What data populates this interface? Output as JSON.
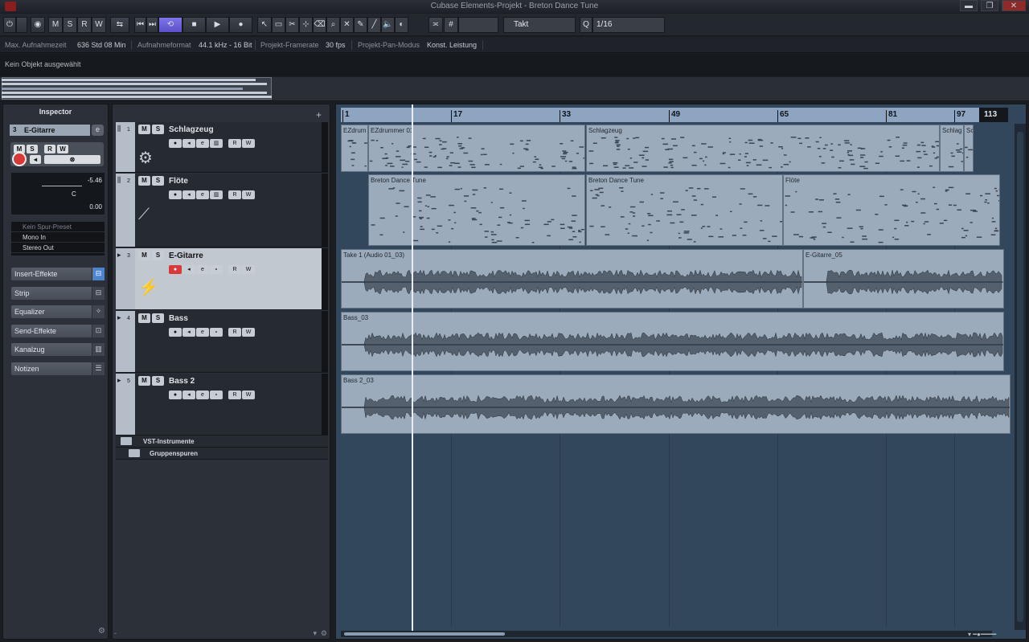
{
  "window": {
    "title": "Cubase Elements-Projekt - Breton Dance Tune",
    "minimize": "▬",
    "restore": "❐",
    "close": "✕"
  },
  "toolbar": {
    "btn_activate": "⏻",
    "btn_constrain": "◉",
    "btn_m": "M",
    "btn_s": "S",
    "btn_r": "R",
    "btn_w": "W",
    "btn_automation": "⇆",
    "btn_prev": "⏮",
    "btn_next": "⏭",
    "btn_cycle": "⟲",
    "btn_stop": "■",
    "btn_play": "▶",
    "btn_record": "●",
    "tool_arrow": "↖",
    "tool_range": "▭",
    "tool_split": "✂",
    "tool_glue": "⊹",
    "tool_erase": "⌫",
    "tool_zoom": "⌕",
    "tool_mute": "✕",
    "tool_draw": "✎",
    "tool_line": "╱",
    "tool_play": "🔈",
    "tool_color": "◐",
    "snap_toggle": "≍",
    "grid_icon": "#",
    "grid_type": "Takt",
    "quantize_label": "Q",
    "quantize_value": "1/16"
  },
  "status": {
    "rec_time_label": "Max. Aufnahmezeit",
    "rec_time_value": "636 Std 08 Min",
    "rec_format_label": "Aufnahmeformat",
    "rec_format_value": "44.1 kHz - 16 Bit",
    "framerate_label": "Projekt-Framerate",
    "framerate_value": "30 fps",
    "pan_label": "Projekt-Pan-Modus",
    "pan_value": "Konst. Leistung"
  },
  "infoline": "Kein Objekt ausgewählt",
  "inspector": {
    "title": "Inspector",
    "track_num": "3",
    "track_name": "E-Gitarre",
    "btn_m": "M",
    "btn_s": "S",
    "btn_r": "R",
    "btn_w": "W",
    "volume": "-5.46",
    "pan": "C",
    "delay": "0.00",
    "preset": "Kein Spur-Preset",
    "input": "Mono In",
    "output": "Stereo Out",
    "sections": [
      "Insert-Effekte",
      "Strip",
      "Equalizer",
      "Send-Effekte",
      "Kanalzug",
      "Notizen"
    ]
  },
  "tracks": [
    {
      "num": "1",
      "name": "Schlagzeug",
      "m": "M",
      "s": "S",
      "r": "R",
      "w": "W"
    },
    {
      "num": "2",
      "name": "Flöte",
      "m": "M",
      "s": "S",
      "r": "R",
      "w": "W"
    },
    {
      "num": "3",
      "name": "E-Gitarre",
      "m": "M",
      "s": "S",
      "r": "R",
      "w": "W"
    },
    {
      "num": "4",
      "name": "Bass",
      "m": "M",
      "s": "S",
      "r": "R",
      "w": "W"
    },
    {
      "num": "5",
      "name": "Bass 2",
      "m": "M",
      "s": "S",
      "r": "R",
      "w": "W"
    }
  ],
  "folders": [
    "VST-Instrumente",
    "Gruppenspuren"
  ],
  "ruler": [
    "1",
    "17",
    "33",
    "49",
    "65",
    "81",
    "97",
    "113"
  ],
  "parts": {
    "drums": [
      "EZdrum",
      "EZdrummer 01",
      "Schlagzeug",
      "Schlag",
      "Sc"
    ],
    "flute": [
      "Breton Dance Tune",
      "Breton Dance Tune",
      "Flöte"
    ],
    "guitar": [
      "Take 1 (Audio 01_03)",
      "E-Gitarre_05"
    ],
    "bass": [
      "Bass_03"
    ],
    "bass2": [
      "Bass 2_03"
    ]
  }
}
